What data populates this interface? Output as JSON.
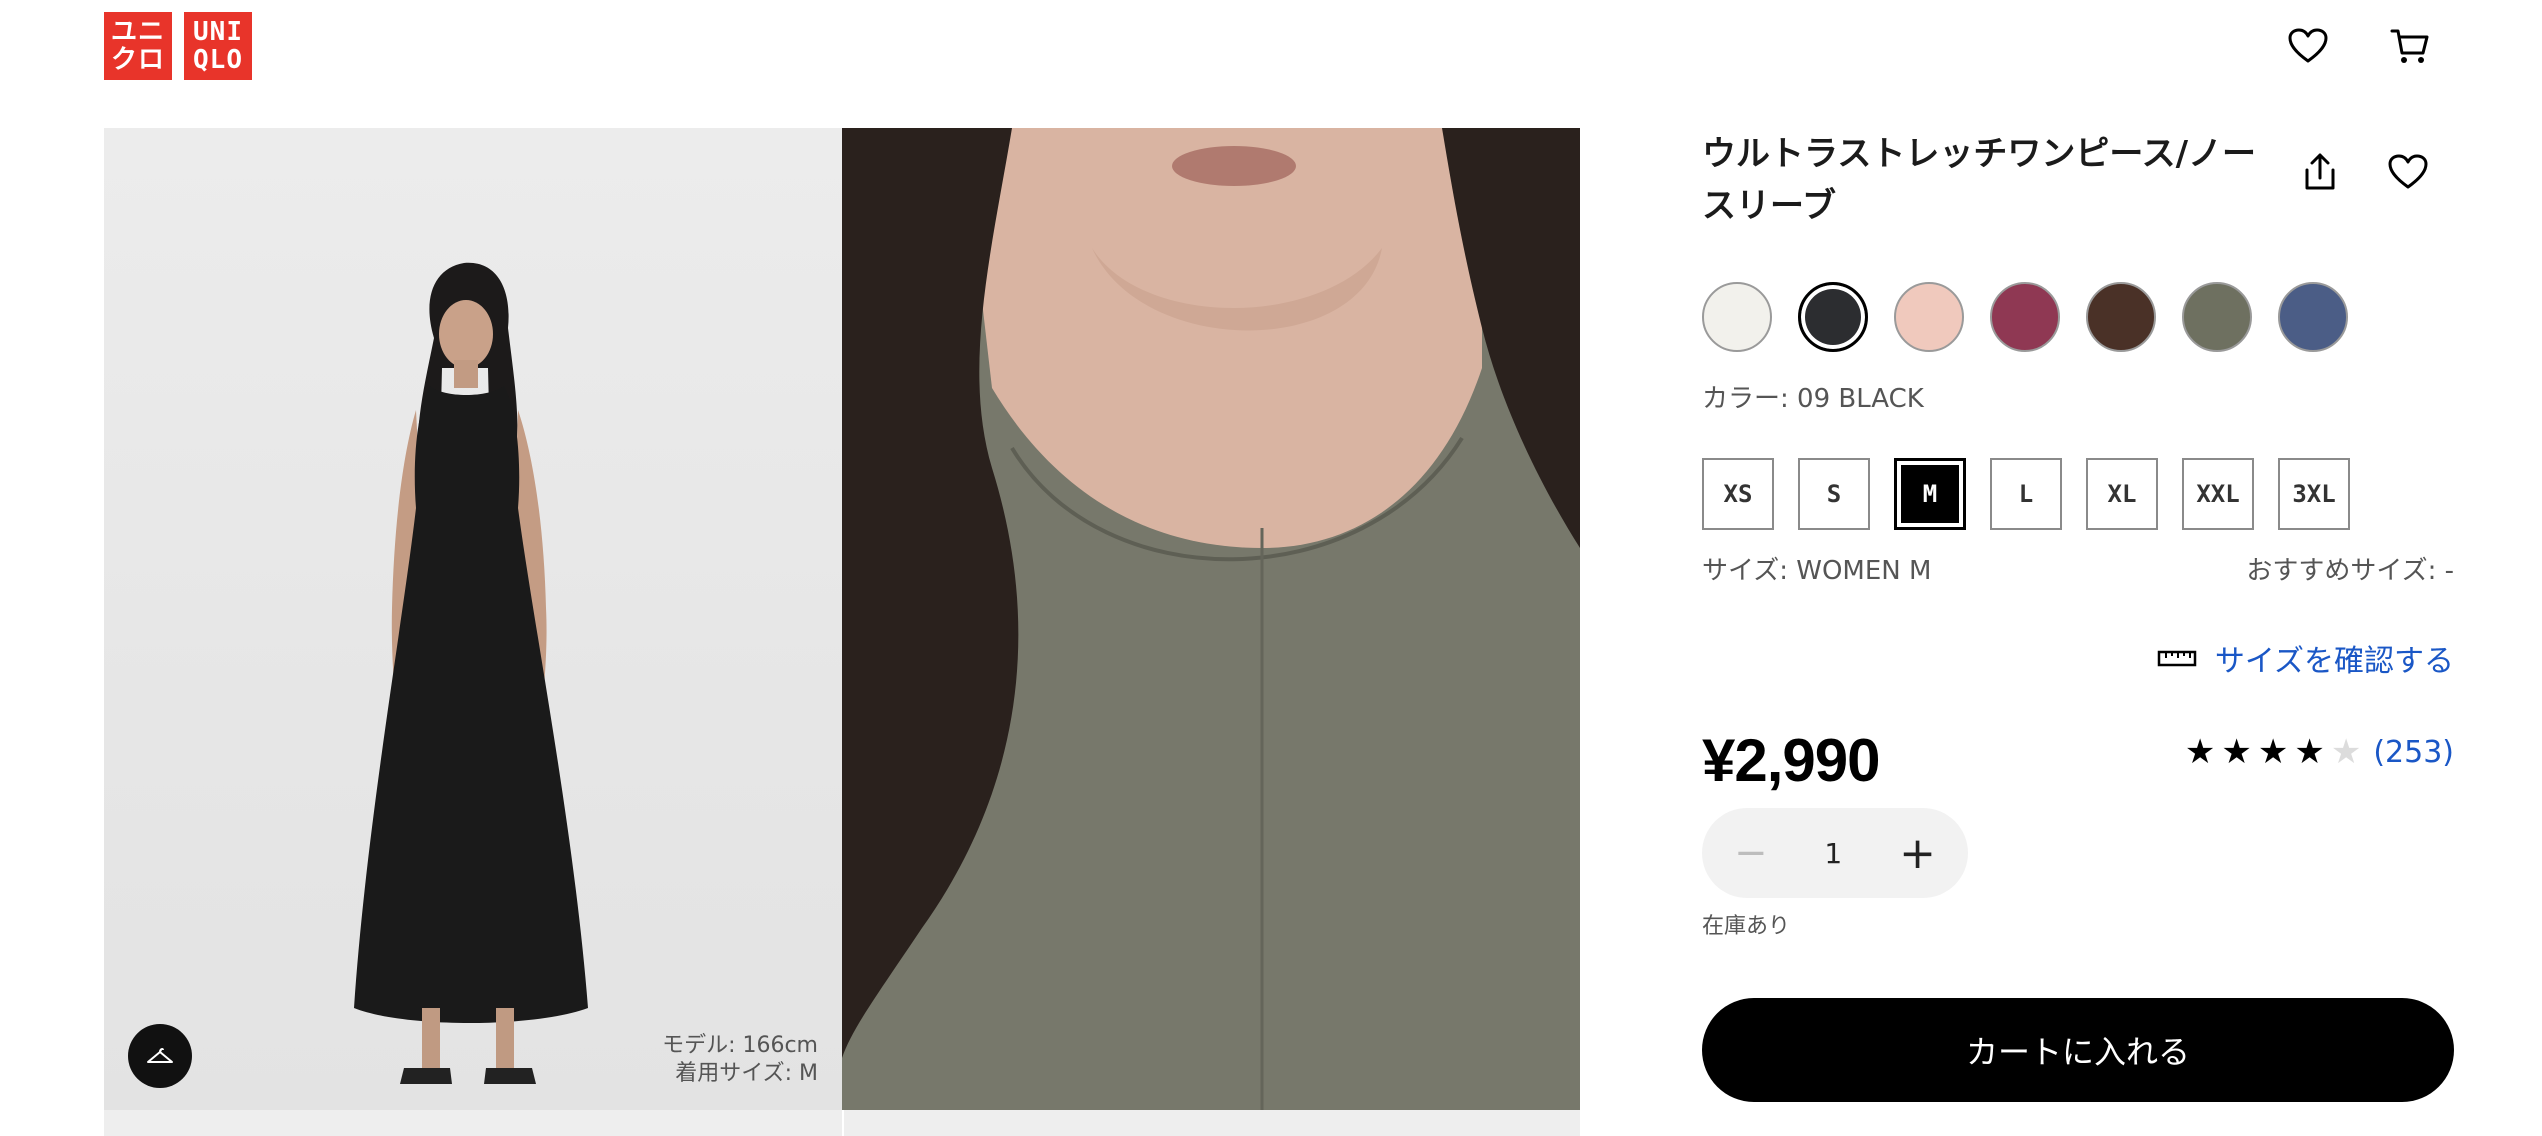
{
  "header": {
    "logo_text": [
      "ユニ",
      "クロ",
      "UNI",
      "QLO"
    ],
    "wishlist_icon": "heart-icon",
    "cart_icon": "cart-icon"
  },
  "gallery": {
    "model_info_line1": "モデル: 166cm",
    "model_info_line2": "着用サイズ: M",
    "fit_icon": "hanger-icon",
    "video_control_icon": "pause-icon"
  },
  "product": {
    "title": "ウルトラストレッチワンピース/ノースリーブ",
    "share_icon": "share-icon",
    "favorite_icon": "heart-icon",
    "colors": [
      {
        "hex": "#f2f1ec",
        "selected": false
      },
      {
        "hex": "#2c2d30",
        "selected": true
      },
      {
        "hex": "#f0c9bd",
        "selected": false
      },
      {
        "hex": "#8f3853",
        "selected": false
      },
      {
        "hex": "#4a3127",
        "selected": false
      },
      {
        "hex": "#6e7060",
        "selected": false
      },
      {
        "hex": "#4b5d86",
        "selected": false
      }
    ],
    "color_label": "カラー: 09 BLACK",
    "sizes": [
      {
        "label": "XS",
        "selected": false
      },
      {
        "label": "S",
        "selected": false
      },
      {
        "label": "M",
        "selected": true
      },
      {
        "label": "L",
        "selected": false
      },
      {
        "label": "XL",
        "selected": false
      },
      {
        "label": "XXL",
        "selected": false
      },
      {
        "label": "3XL",
        "selected": false
      }
    ],
    "size_label": "サイズ: WOMEN M",
    "recommended_size": "おすすめサイズ: -",
    "size_check_link": "サイズを確認する",
    "price": "¥2,990",
    "rating": {
      "stars": 4,
      "max": 5,
      "count": "(253)"
    },
    "quantity": {
      "minus": "−",
      "value": "1",
      "plus": "+"
    },
    "stock_status": "在庫あり",
    "add_to_cart": "カートに入れる"
  },
  "colors": {
    "brand_red": "#e8342a",
    "link_blue": "#1a57c6"
  }
}
